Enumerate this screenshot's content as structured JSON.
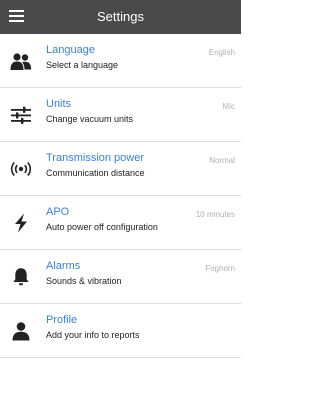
{
  "header": {
    "title": "Settings",
    "menu_icon": "hamburger-menu-icon",
    "background": "#4a4a4a"
  },
  "accent_color": "#3b7fd6",
  "settings": [
    {
      "title": "Language",
      "subtitle": "Select a language",
      "value": "English",
      "icon": "people-icon"
    },
    {
      "title": "Units",
      "subtitle": "Change vacuum units",
      "value": "Mic",
      "icon": "sliders-icon"
    },
    {
      "title": "Transmission power",
      "subtitle": "Communication distance",
      "value": "Normal",
      "icon": "broadcast-icon"
    },
    {
      "title": "APO",
      "subtitle": "Auto power off configuration",
      "value": "10 minutes",
      "icon": "lightning-icon"
    },
    {
      "title": "Alarms",
      "subtitle": "Sounds & vibration",
      "value": "Foghorn",
      "icon": "bell-icon"
    },
    {
      "title": "Profile",
      "subtitle": "Add your info to reports",
      "value": "",
      "icon": "person-icon"
    }
  ]
}
